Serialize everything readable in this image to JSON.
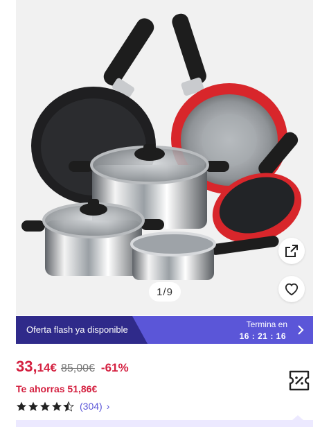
{
  "gallery": {
    "image_alt": "Batería de cocina con sartenes y cacerolas",
    "counter": "1/9",
    "share_icon": "share-icon",
    "favorite_icon": "heart-icon"
  },
  "flash": {
    "label": "Oferta flash ya disponible",
    "ends_label": "Termina en",
    "ends_time": "16 : 21 : 16",
    "chevron_icon": "chevron-right-icon",
    "color_dark": "#2f2a8a",
    "color_light": "#5b56d8"
  },
  "price": {
    "current_int": "33,",
    "current_dec": "14€",
    "original": "85,00€",
    "discount": "-61%",
    "color": "#d41f3f"
  },
  "savings": "Te ahorras 51,86€",
  "rating": {
    "stars": 4.5,
    "count": "(304)",
    "chevron": "›"
  },
  "coupon_icon": "coupon-icon"
}
